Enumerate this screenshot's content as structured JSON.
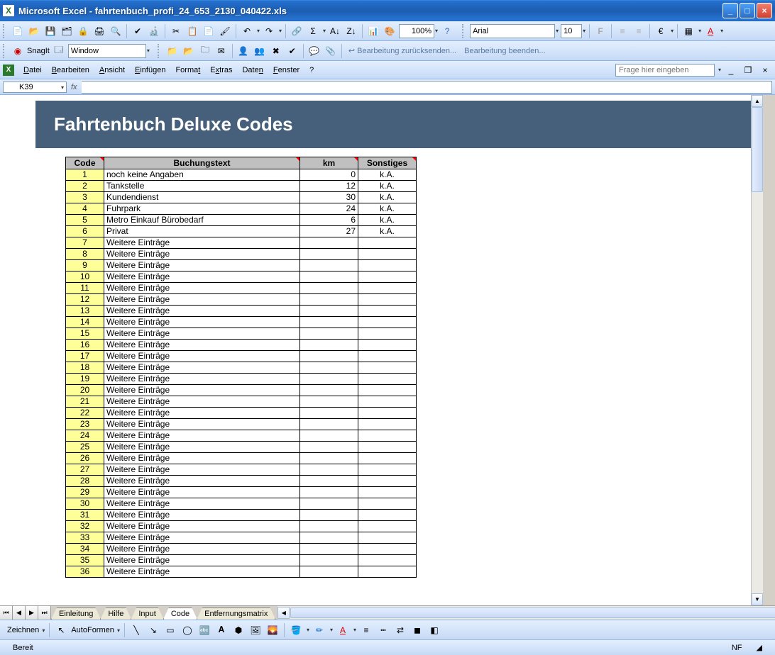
{
  "window": {
    "app": "Microsoft Excel",
    "filename": "fahrtenbuch_profi_24_653_2130_040422.xls"
  },
  "toolbar1": {
    "zoom": "100%",
    "font_name": "Arial",
    "font_size": "10"
  },
  "snagit": {
    "label": "SnagIt",
    "mode": "Window"
  },
  "review": {
    "send_back": "Bearbeitung zurücksenden...",
    "end": "Bearbeitung beenden..."
  },
  "menus": {
    "datei": "Datei",
    "bearbeiten": "Bearbeiten",
    "ansicht": "Ansicht",
    "einfugen": "Einfügen",
    "format": "Format",
    "extras": "Extras",
    "daten": "Daten",
    "fenster": "Fenster",
    "help": "?"
  },
  "help_box": "Frage hier eingeben",
  "name_box": "K39",
  "sheet_title": "Fahrtenbuch Deluxe Codes",
  "headers": {
    "code": "Code",
    "text": "Buchungstext",
    "km": "km",
    "other": "Sonstiges"
  },
  "rows": [
    {
      "code": "1",
      "text": "noch keine Angaben",
      "km": "0",
      "other": "k.A."
    },
    {
      "code": "2",
      "text": "Tankstelle",
      "km": "12",
      "other": "k.A."
    },
    {
      "code": "3",
      "text": "Kundendienst",
      "km": "30",
      "other": "k.A."
    },
    {
      "code": "4",
      "text": "Fuhrpark",
      "km": "24",
      "other": "k.A."
    },
    {
      "code": "5",
      "text": "Metro Einkauf Bürobedarf",
      "km": "6",
      "other": "k.A."
    },
    {
      "code": "6",
      "text": "Privat",
      "km": "27",
      "other": "k.A."
    },
    {
      "code": "7",
      "text": "Weitere Einträge",
      "km": "",
      "other": ""
    },
    {
      "code": "8",
      "text": "Weitere Einträge",
      "km": "",
      "other": ""
    },
    {
      "code": "9",
      "text": "Weitere Einträge",
      "km": "",
      "other": ""
    },
    {
      "code": "10",
      "text": "Weitere Einträge",
      "km": "",
      "other": ""
    },
    {
      "code": "11",
      "text": "Weitere Einträge",
      "km": "",
      "other": ""
    },
    {
      "code": "12",
      "text": "Weitere Einträge",
      "km": "",
      "other": ""
    },
    {
      "code": "13",
      "text": "Weitere Einträge",
      "km": "",
      "other": ""
    },
    {
      "code": "14",
      "text": "Weitere Einträge",
      "km": "",
      "other": ""
    },
    {
      "code": "15",
      "text": "Weitere Einträge",
      "km": "",
      "other": ""
    },
    {
      "code": "16",
      "text": "Weitere Einträge",
      "km": "",
      "other": ""
    },
    {
      "code": "17",
      "text": "Weitere Einträge",
      "km": "",
      "other": ""
    },
    {
      "code": "18",
      "text": "Weitere Einträge",
      "km": "",
      "other": ""
    },
    {
      "code": "19",
      "text": "Weitere Einträge",
      "km": "",
      "other": ""
    },
    {
      "code": "20",
      "text": "Weitere Einträge",
      "km": "",
      "other": ""
    },
    {
      "code": "21",
      "text": "Weitere Einträge",
      "km": "",
      "other": ""
    },
    {
      "code": "22",
      "text": "Weitere Einträge",
      "km": "",
      "other": ""
    },
    {
      "code": "23",
      "text": "Weitere Einträge",
      "km": "",
      "other": ""
    },
    {
      "code": "24",
      "text": "Weitere Einträge",
      "km": "",
      "other": ""
    },
    {
      "code": "25",
      "text": "Weitere Einträge",
      "km": "",
      "other": ""
    },
    {
      "code": "26",
      "text": "Weitere Einträge",
      "km": "",
      "other": ""
    },
    {
      "code": "27",
      "text": "Weitere Einträge",
      "km": "",
      "other": ""
    },
    {
      "code": "28",
      "text": "Weitere Einträge",
      "km": "",
      "other": ""
    },
    {
      "code": "29",
      "text": "Weitere Einträge",
      "km": "",
      "other": ""
    },
    {
      "code": "30",
      "text": "Weitere Einträge",
      "km": "",
      "other": ""
    },
    {
      "code": "31",
      "text": "Weitere Einträge",
      "km": "",
      "other": ""
    },
    {
      "code": "32",
      "text": "Weitere Einträge",
      "km": "",
      "other": ""
    },
    {
      "code": "33",
      "text": "Weitere Einträge",
      "km": "",
      "other": ""
    },
    {
      "code": "34",
      "text": "Weitere Einträge",
      "km": "",
      "other": ""
    },
    {
      "code": "35",
      "text": "Weitere Einträge",
      "km": "",
      "other": ""
    },
    {
      "code": "36",
      "text": "Weitere Einträge",
      "km": "",
      "other": ""
    }
  ],
  "tabs": [
    "Einleitung",
    "Hilfe",
    "Input",
    "Code",
    "Entfernungsmatrix"
  ],
  "tabs_active_index": 3,
  "draw_bar": {
    "zeichnen": "Zeichnen",
    "autoformen": "AutoFormen"
  },
  "status": {
    "ready": "Bereit",
    "nf": "NF"
  }
}
